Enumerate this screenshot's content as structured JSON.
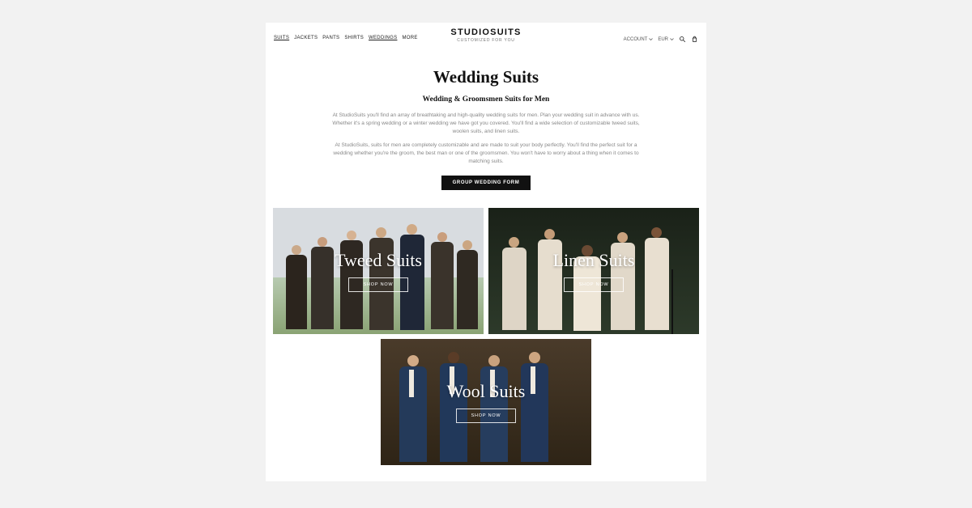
{
  "nav": {
    "items": [
      "SUITS",
      "JACKETS",
      "PANTS",
      "SHIRTS",
      "WEDDINGS",
      "MORE"
    ]
  },
  "brand": {
    "name": "STUDIOSUITS",
    "tagline": "CUSTOMIZED FOR YOU"
  },
  "header_right": {
    "account": "ACCOUNT",
    "currency": "EUR"
  },
  "hero": {
    "title": "Wedding Suits",
    "subtitle": "Wedding & Groomsmen Suits for Men",
    "p1": "At StudioSuits you'll find an array of breathtaking and high-quality wedding suits for men. Plan your wedding suit in advance with us. Whether it's a spring wedding or a winter wedding we have got you covered. You'll find a wide selection of customizable tweed suits, woolen suits, and linen suits.",
    "p2": "At StudioSuits, suits for men are completely customizable and are made to suit your body perfectly. You'll find the perfect suit for a wedding whether you're the groom, the best man or one of the groomsmen. You won't have to worry about a thing when it comes to matching suits.",
    "cta": "GROUP WEDDING FORM"
  },
  "cards": [
    {
      "title": "Tweed Suits",
      "btn": "SHOP NOW"
    },
    {
      "title": "Linen Suits",
      "btn": "SHOP NOW"
    },
    {
      "title": "Wool Suits",
      "btn": "SHOP NOW"
    }
  ]
}
